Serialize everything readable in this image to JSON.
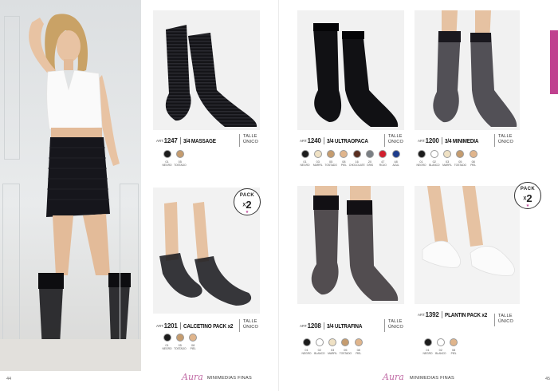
{
  "colors": {
    "accent": "#c0418f",
    "brand": "#c06aa5"
  },
  "products": [
    {
      "art_label": "ART.",
      "art": "1247",
      "name": "3/4 MASSAGE",
      "talle": [
        "TALLE",
        "ÚNICO"
      ],
      "colors": [
        {
          "code": "01",
          "name": "NEGRO",
          "hex": "#1c1c1c"
        },
        {
          "code": "05",
          "name": "TOSTADO",
          "hex": "#c59c6f"
        }
      ]
    },
    {
      "art_label": "ART.",
      "art": "1240",
      "name": "3/4 ULTRAOPACA",
      "talle": [
        "TALLE",
        "ÚNICO"
      ],
      "colors": [
        {
          "code": "01",
          "name": "NEGRO",
          "hex": "#1c1c1c"
        },
        {
          "code": "03",
          "name": "MARFIL",
          "hex": "#efe1c4"
        },
        {
          "code": "05",
          "name": "TOSTADO",
          "hex": "#c59c6f"
        },
        {
          "code": "08",
          "name": "PIEL",
          "hex": "#e0b58c"
        },
        {
          "code": "16",
          "name": "CHOCOLATE",
          "hex": "#5a2f20"
        },
        {
          "code": "20",
          "name": "GRIS",
          "hex": "#7a7f84"
        },
        {
          "code": "47",
          "name": "ROJO",
          "hex": "#d11f2e"
        },
        {
          "code": "48",
          "name": "AZUL",
          "hex": "#1e3c8c"
        }
      ]
    },
    {
      "art_label": "ART.",
      "art": "1200",
      "name": "3/4 MINIMEDIA",
      "talle": [
        "TALLE",
        "ÚNICO"
      ],
      "colors": [
        {
          "code": "01",
          "name": "NEGRO",
          "hex": "#1c1c1c"
        },
        {
          "code": "02",
          "name": "BLANCO",
          "hex": "#ffffff"
        },
        {
          "code": "03",
          "name": "MARFIL",
          "hex": "#efe1c4"
        },
        {
          "code": "05",
          "name": "TOSTADO",
          "hex": "#c59c6f"
        },
        {
          "code": "08",
          "name": "PIEL",
          "hex": "#e0b58c"
        }
      ]
    },
    {
      "art_label": "ART.",
      "art": "1201",
      "name": "CALCETINO PACK x2",
      "talle": [
        "TALLE",
        "ÚNICO"
      ],
      "colors": [
        {
          "code": "01",
          "name": "NEGRO",
          "hex": "#1c1c1c"
        },
        {
          "code": "05",
          "name": "TOSTADO",
          "hex": "#c59c6f"
        },
        {
          "code": "08",
          "name": "PIEL",
          "hex": "#e0b58c"
        }
      ]
    },
    {
      "art_label": "ART.",
      "art": "1208",
      "name": "3/4 ULTRAFINA",
      "talle": [
        "TALLE",
        "ÚNICO"
      ],
      "colors": [
        {
          "code": "01",
          "name": "NEGRO",
          "hex": "#1c1c1c"
        },
        {
          "code": "02",
          "name": "BLANCO",
          "hex": "#ffffff"
        },
        {
          "code": "03",
          "name": "MARFIL",
          "hex": "#efe1c4"
        },
        {
          "code": "05",
          "name": "TOSTADO",
          "hex": "#c59c6f"
        },
        {
          "code": "08",
          "name": "PIEL",
          "hex": "#e0b58c"
        }
      ]
    },
    {
      "art_label": "ART.",
      "art": "1392",
      "name": "PLANTIN PACK x2",
      "talle": [
        "TALLE",
        "ÚNICO"
      ],
      "colors": [
        {
          "code": "01",
          "name": "NEGRO",
          "hex": "#1c1c1c"
        },
        {
          "code": "02",
          "name": "BLANCO",
          "hex": "#ffffff"
        },
        {
          "code": "08",
          "name": "PIEL",
          "hex": "#e0b58c"
        }
      ]
    }
  ],
  "pack_badge": {
    "pack": "PACK",
    "count": "2",
    "x": "X"
  },
  "footer": {
    "brand": "Aura",
    "section": "MINIMEDIAS FINAS"
  },
  "pages": {
    "left": "44",
    "right": "45"
  }
}
